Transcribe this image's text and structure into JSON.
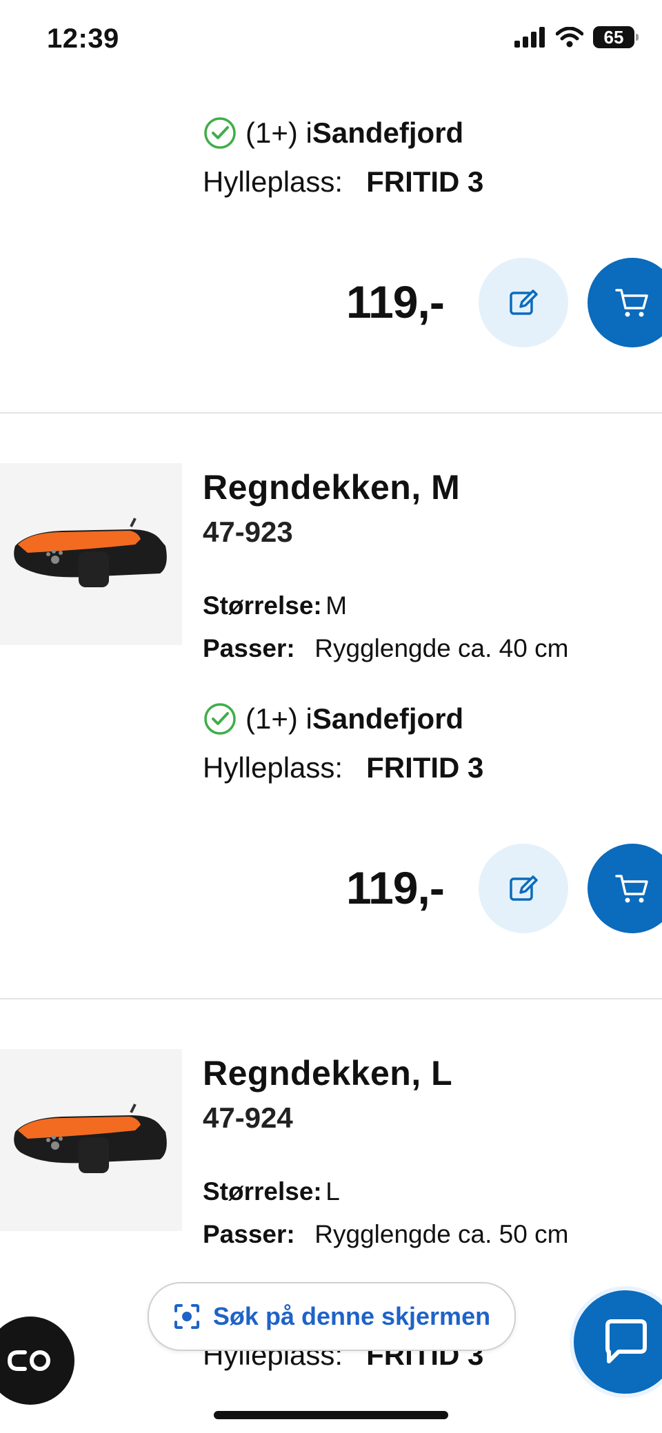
{
  "status_bar": {
    "time": "12:39",
    "battery": "65"
  },
  "products": [
    {
      "stock_qty": "(1+) i ",
      "stock_location": "Sandefjord",
      "shelf_label": "Hylleplass:",
      "shelf_value": "FRITID 3",
      "price": "119,-"
    },
    {
      "title": "Regndekken, M",
      "sku": "47-923",
      "size_label": "Størrelse:",
      "size_value": "M",
      "fits_label": "Passer:",
      "fits_value": "Rygglengde ca. 40 cm",
      "stock_qty": "(1+) i ",
      "stock_location": "Sandefjord",
      "shelf_label": "Hylleplass:",
      "shelf_value": "FRITID 3",
      "price": "119,-"
    },
    {
      "title": "Regndekken, L",
      "sku": "47-924",
      "size_label": "Størrelse:",
      "size_value": "L",
      "fits_label": "Passer:",
      "fits_value": "Rygglengde ca. 50 cm",
      "shelf_label": "Hylleplass:",
      "shelf_value": "FRITID 3"
    }
  ],
  "search_pill": {
    "label": "Søk på denne skjermen"
  },
  "colors": {
    "primary": "#0b6bbd",
    "primary_light": "#e4f1fb",
    "check": "#3fae49",
    "link": "#1f63c7"
  }
}
